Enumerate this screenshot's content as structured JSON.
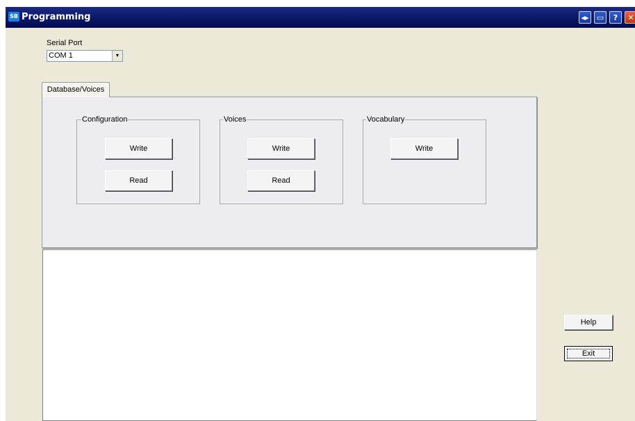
{
  "window": {
    "title": "Programming",
    "app_icon": "app-icon",
    "title_buttons": [
      "◂▸",
      "▭",
      "?",
      "✕"
    ]
  },
  "serial_port": {
    "label": "Serial Port",
    "value": "COM 1"
  },
  "tabs": [
    {
      "label": "Database/Voices",
      "selected": true
    }
  ],
  "groups": {
    "configuration": {
      "title": "Configuration",
      "write_label": "Write",
      "read_label": "Read"
    },
    "voices": {
      "title": "Voices",
      "write_label": "Write",
      "read_label": "Read"
    },
    "vocabulary": {
      "title": "Vocabulary",
      "write_label": "Write"
    }
  },
  "side": {
    "help_label": "Help",
    "exit_label": "Exit"
  }
}
